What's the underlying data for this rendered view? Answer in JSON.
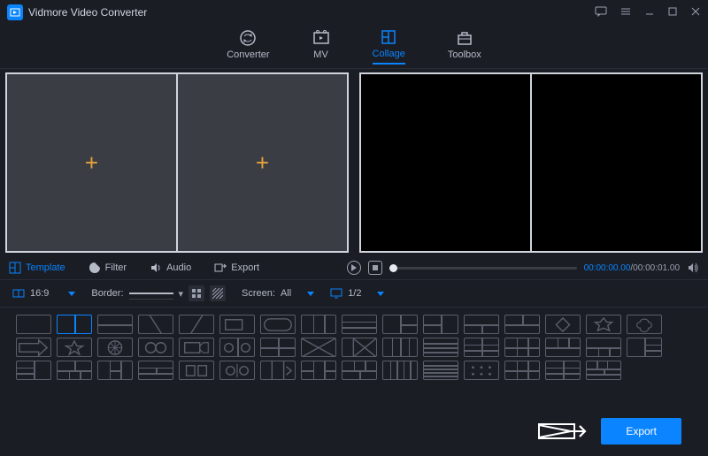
{
  "app": {
    "title": "Vidmore Video Converter"
  },
  "main_tabs": {
    "converter": "Converter",
    "mv": "MV",
    "collage": "Collage",
    "toolbox": "Toolbox",
    "active": "collage"
  },
  "mid_tabs": {
    "template": "Template",
    "filter": "Filter",
    "audio": "Audio",
    "export": "Export"
  },
  "player": {
    "current": "00:00:00.00",
    "duration": "00:00:01.00",
    "separator": "/"
  },
  "options": {
    "ratio": "16:9",
    "border_label": "Border:",
    "screen_label": "Screen:",
    "screen_value": "All",
    "page_value": "1/2"
  },
  "footer": {
    "export": "Export"
  },
  "colors": {
    "accent": "#0a84ff",
    "plus": "#e6a23c"
  }
}
